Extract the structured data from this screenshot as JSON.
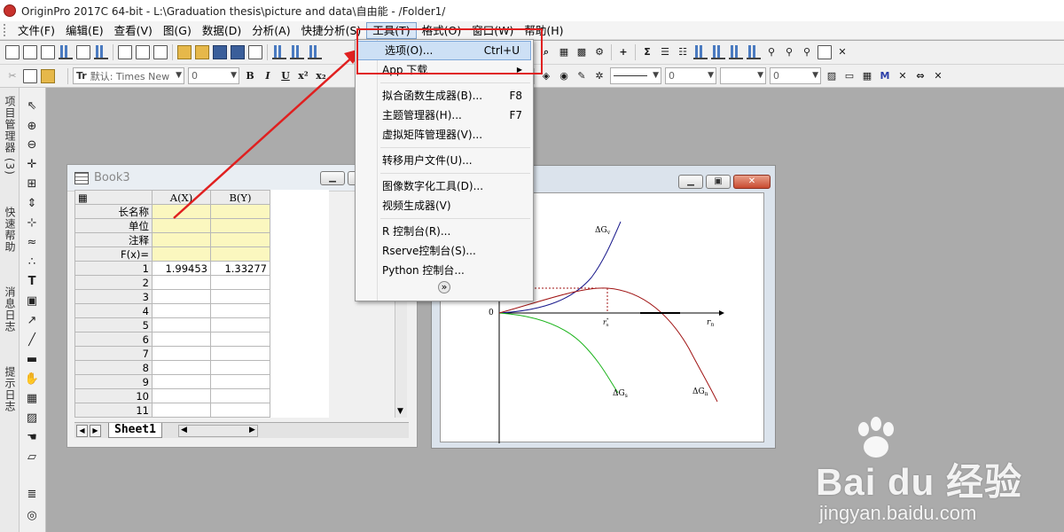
{
  "window": {
    "title": "OriginPro 2017C 64-bit - L:\\Graduation thesis\\picture and data\\自由能 - /Folder1/"
  },
  "menubar": {
    "items": [
      "文件(F)",
      "编辑(E)",
      "查看(V)",
      "图(G)",
      "数据(D)",
      "分析(A)",
      "快捷分析(S)",
      "工具(T)",
      "格式(O)",
      "窗口(W)",
      "帮助(H)"
    ],
    "active_index": 7
  },
  "format_toolbar": {
    "font_label": "默认: Times New",
    "font_size": "0",
    "bold": "B",
    "italic": "I",
    "underline": "U",
    "superscript": "x²",
    "subscript": "x₂",
    "line_width": "0",
    "line_width_2": "0"
  },
  "left_panel": {
    "tabs": [
      "项目管理器 (3)",
      "快速帮助",
      "消息日志",
      "提示日志"
    ]
  },
  "workbook": {
    "title": "Book3",
    "columns": [
      "A(X)",
      "B(Y)"
    ],
    "header_rows": [
      "长名称",
      "单位",
      "注释",
      "F(x)="
    ],
    "data_rows": [
      {
        "n": "1",
        "a": "1.99453",
        "b": "1.33277"
      },
      {
        "n": "2",
        "a": "",
        "b": ""
      },
      {
        "n": "3",
        "a": "",
        "b": ""
      },
      {
        "n": "4",
        "a": "",
        "b": ""
      },
      {
        "n": "5",
        "a": "",
        "b": ""
      },
      {
        "n": "6",
        "a": "",
        "b": ""
      },
      {
        "n": "7",
        "a": "",
        "b": ""
      },
      {
        "n": "8",
        "a": "",
        "b": ""
      },
      {
        "n": "9",
        "a": "",
        "b": ""
      },
      {
        "n": "10",
        "a": "",
        "b": ""
      },
      {
        "n": "11",
        "a": "",
        "b": ""
      }
    ],
    "sheet_tab": "Sheet1"
  },
  "graph": {
    "zero_label": "0",
    "curve_top": "ΔG",
    "curve_top_sub": "v",
    "curve_green": "ΔG",
    "curve_green_sub": "s",
    "curve_red": "ΔG",
    "curve_red_sub": "n",
    "axis_r": "r",
    "axis_r_sub": "n",
    "crit_r": "r",
    "crit_r_sub": "n",
    "crit_r_sup": "*"
  },
  "tools_menu": {
    "items": [
      {
        "label": "选项(O)...",
        "shortcut": "Ctrl+U",
        "highlight": true
      },
      {
        "label": "App 下载",
        "shortcut": "",
        "submenu": true
      },
      {
        "separator": true
      },
      {
        "label": "拟合函数生成器(B)...",
        "shortcut": "F8"
      },
      {
        "label": "主题管理器(H)...",
        "shortcut": "F7"
      },
      {
        "label": "虚拟矩阵管理器(V)...",
        "shortcut": ""
      },
      {
        "separator": true
      },
      {
        "label": "转移用户文件(U)...",
        "shortcut": ""
      },
      {
        "separator": true
      },
      {
        "label": "图像数字化工具(D)...",
        "shortcut": ""
      },
      {
        "label": "视频生成器(V)",
        "shortcut": ""
      },
      {
        "separator": true
      },
      {
        "label": "R 控制台(R)...",
        "shortcut": ""
      },
      {
        "label": "Rserve控制台(S)...",
        "shortcut": ""
      },
      {
        "label": "Python 控制台...",
        "shortcut": ""
      }
    ],
    "more_glyph": "»"
  },
  "watermark": {
    "brand": "Bai du 经验",
    "url": "jingyan.baidu.com"
  },
  "colors": {
    "annotation_red": "#e02020",
    "curve_blue": "#1a1a8c",
    "curve_green": "#1ab31a",
    "curve_red": "#a01414",
    "highlight": "#cde0f5"
  },
  "icons": {
    "select_tool": "arrow-pointer",
    "zoom_in": "magnifier-plus",
    "text_tool": "T",
    "line_tool": "line"
  }
}
